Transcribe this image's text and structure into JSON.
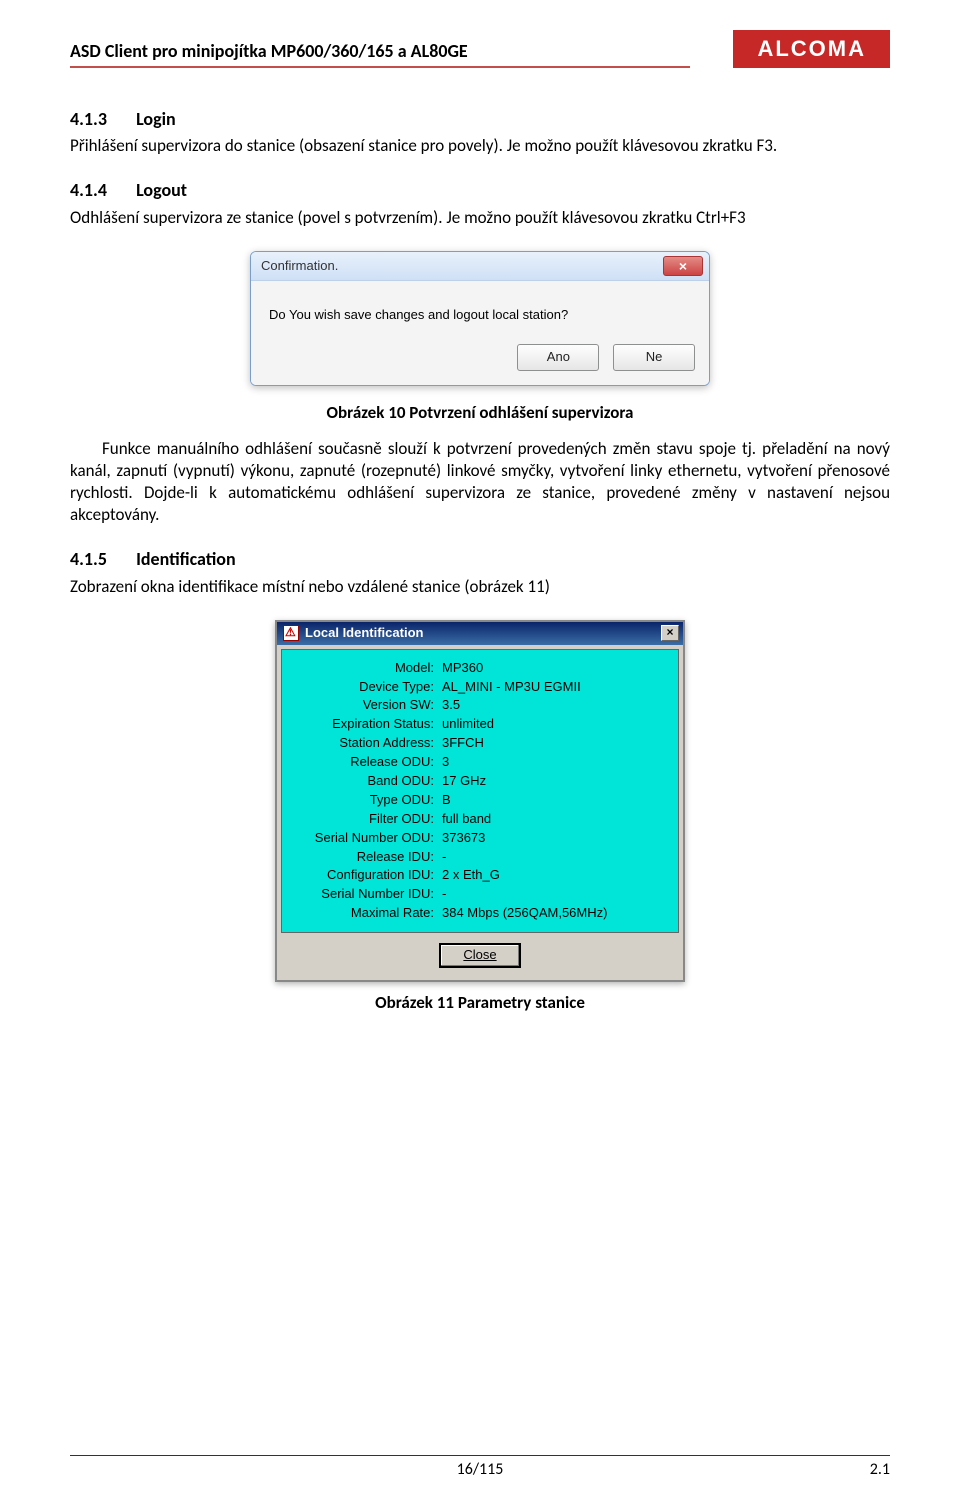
{
  "header": {
    "title": "ASD Client pro minipojítka MP600/360/165 a AL80GE",
    "logo": "ALCOMA"
  },
  "sections": {
    "login": {
      "num": "4.1.3",
      "title": "Login",
      "text": "Přihlášení supervizora do stanice (obsazení stanice pro povely). Je možno použít klávesovou zkratku F3."
    },
    "logout": {
      "num": "4.1.4",
      "title": "Logout",
      "text": "Odhlášení supervizora ze stanice (povel s potvrzením). Je možno použít klávesovou zkratku Ctrl+F3"
    },
    "identification": {
      "num": "4.1.5",
      "title": "Identification",
      "text": "Zobrazení okna identifikace místní nebo vzdálené stanice (obrázek 11)"
    }
  },
  "confirmDialog": {
    "title": "Confirmation.",
    "message": "Do You wish save changes and logout local station?",
    "yes": "Ano",
    "no": "Ne"
  },
  "caption10": "Obrázek 10    Potvrzení odhlášení supervizora",
  "afterFig10": "Funkce manuálního odhlášení současně slouží k potvrzení provedených změn stavu spoje tj. přeladění na nový kanál, zapnutí (vypnutí) výkonu, zapnuté (rozepnuté) linkové smyčky, vytvoření linky ethernetu, vytvoření přenosové rychlosti. Dojde-li k automatickému odhlášení supervizora ze stanice, provedené změny v nastavení nejsou akceptovány.",
  "idWindow": {
    "title": "Local Identification",
    "closeBtn": "Close",
    "rows": [
      {
        "label": "Model:",
        "value": "MP360"
      },
      {
        "label": "Device Type:",
        "value": "AL_MINI - MP3U EGMII"
      },
      {
        "label": "Version SW:",
        "value": "3.5"
      },
      {
        "label": "Expiration Status:",
        "value": "unlimited"
      },
      {
        "label": "Station Address:",
        "value": "3FFCH"
      },
      {
        "label": "Release ODU:",
        "value": "3"
      },
      {
        "label": "Band ODU:",
        "value": "17 GHz"
      },
      {
        "label": "Type ODU:",
        "value": "B"
      },
      {
        "label": "Filter ODU:",
        "value": "full band"
      },
      {
        "label": "Serial Number ODU:",
        "value": "373673"
      },
      {
        "label": "Release IDU:",
        "value": "-"
      },
      {
        "label": "Configuration IDU:",
        "value": "2 x Eth_G"
      },
      {
        "label": "Serial Number IDU:",
        "value": "-"
      },
      {
        "label": "Maximal Rate:",
        "value": "384 Mbps (256QAM,56MHz)"
      }
    ]
  },
  "caption11": "Obrázek 11    Parametry stanice",
  "footer": {
    "page": "16/115",
    "version": "2.1"
  }
}
